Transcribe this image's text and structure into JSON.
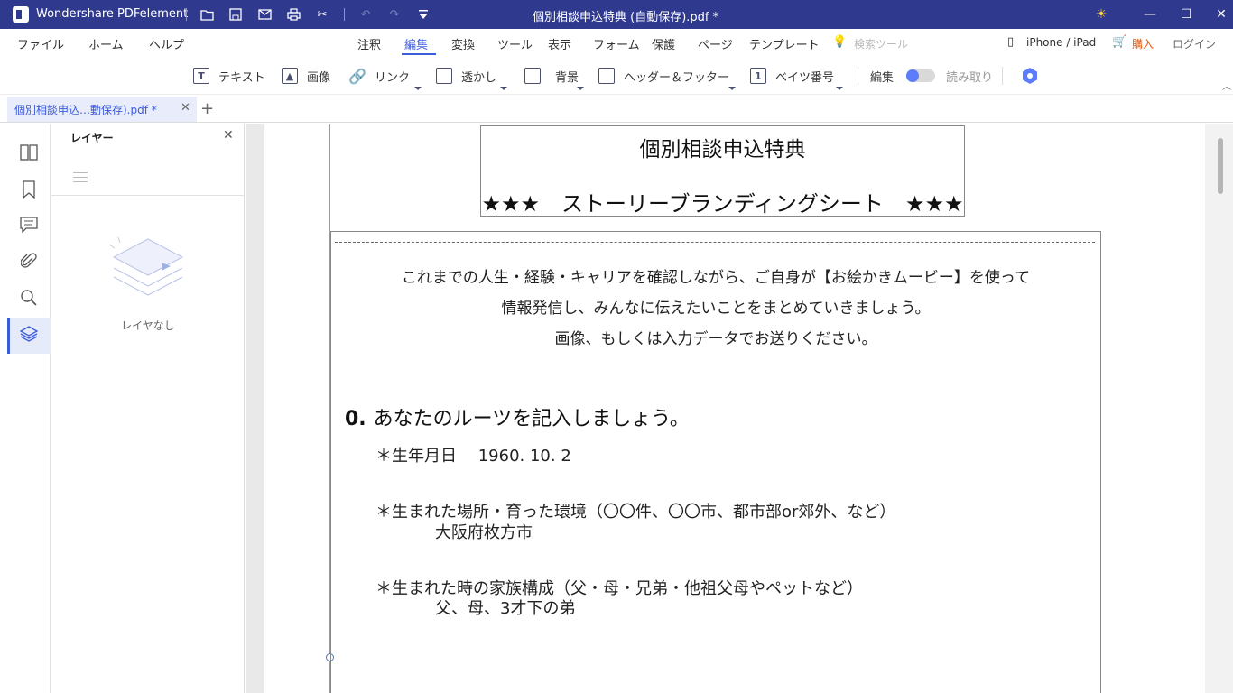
{
  "titlebar": {
    "app_name": "Wondershare PDFelement",
    "document_title": "個別相談申込特典 (自動保存).pdf *",
    "icons": [
      "folder-icon",
      "save-icon",
      "mail-icon",
      "print-icon",
      "scissors-icon",
      "undo-icon",
      "redo-icon",
      "dropdown-icon"
    ]
  },
  "menubar": {
    "left": [
      "ファイル",
      "ホーム",
      "ヘルプ"
    ],
    "center": [
      "注釈",
      "編集",
      "変換",
      "ツール",
      "表示",
      "フォーム",
      "保護",
      "ページ",
      "テンプレート"
    ],
    "search_tool": "検索ツール",
    "device": "iPhone / iPad",
    "buy": "購入",
    "login": "ログイン",
    "active": "編集"
  },
  "toolbar": {
    "text": "テキスト",
    "image": "画像",
    "link": "リンク",
    "watermark": "透かし",
    "background": "背景",
    "header_footer": "ヘッダー＆フッター",
    "bates": "ベイツ番号",
    "edit": "編集",
    "read": "読み取り"
  },
  "tabs": {
    "active_label": "個別相談申込…動保存).pdf *"
  },
  "panel": {
    "title": "レイヤー",
    "empty": "レイヤなし"
  },
  "document": {
    "title_line1": "個別相談申込特典",
    "title_line2": "★★★　ストーリーブランディングシート　★★★",
    "intro": [
      "これまでの人生・経験・キャリアを確認しながら、ご自身が【お絵かきムービー】を使って",
      "情報発信し、みんなに伝えたいことをまとめていきましょう。",
      "画像、もしくは入力データでお送りください。"
    ],
    "section_num": "0.",
    "section_title": "あなたのルーツを記入しましょう。",
    "q1": "＊生年月日　 1960. 10. 2",
    "q2": "＊生まれた場所・育った環境（〇〇件、〇〇市、都市部or郊外、など）",
    "a2": "大阪府枚方市",
    "q3": "＊生まれた時の家族構成（父・母・兄弟・他祖父母やペットなど）",
    "a3": "父、母、3才下の弟"
  },
  "colors": {
    "titlebar": "#2f3a8f",
    "accent": "#3b5bdb",
    "buy": "#e8590c"
  }
}
